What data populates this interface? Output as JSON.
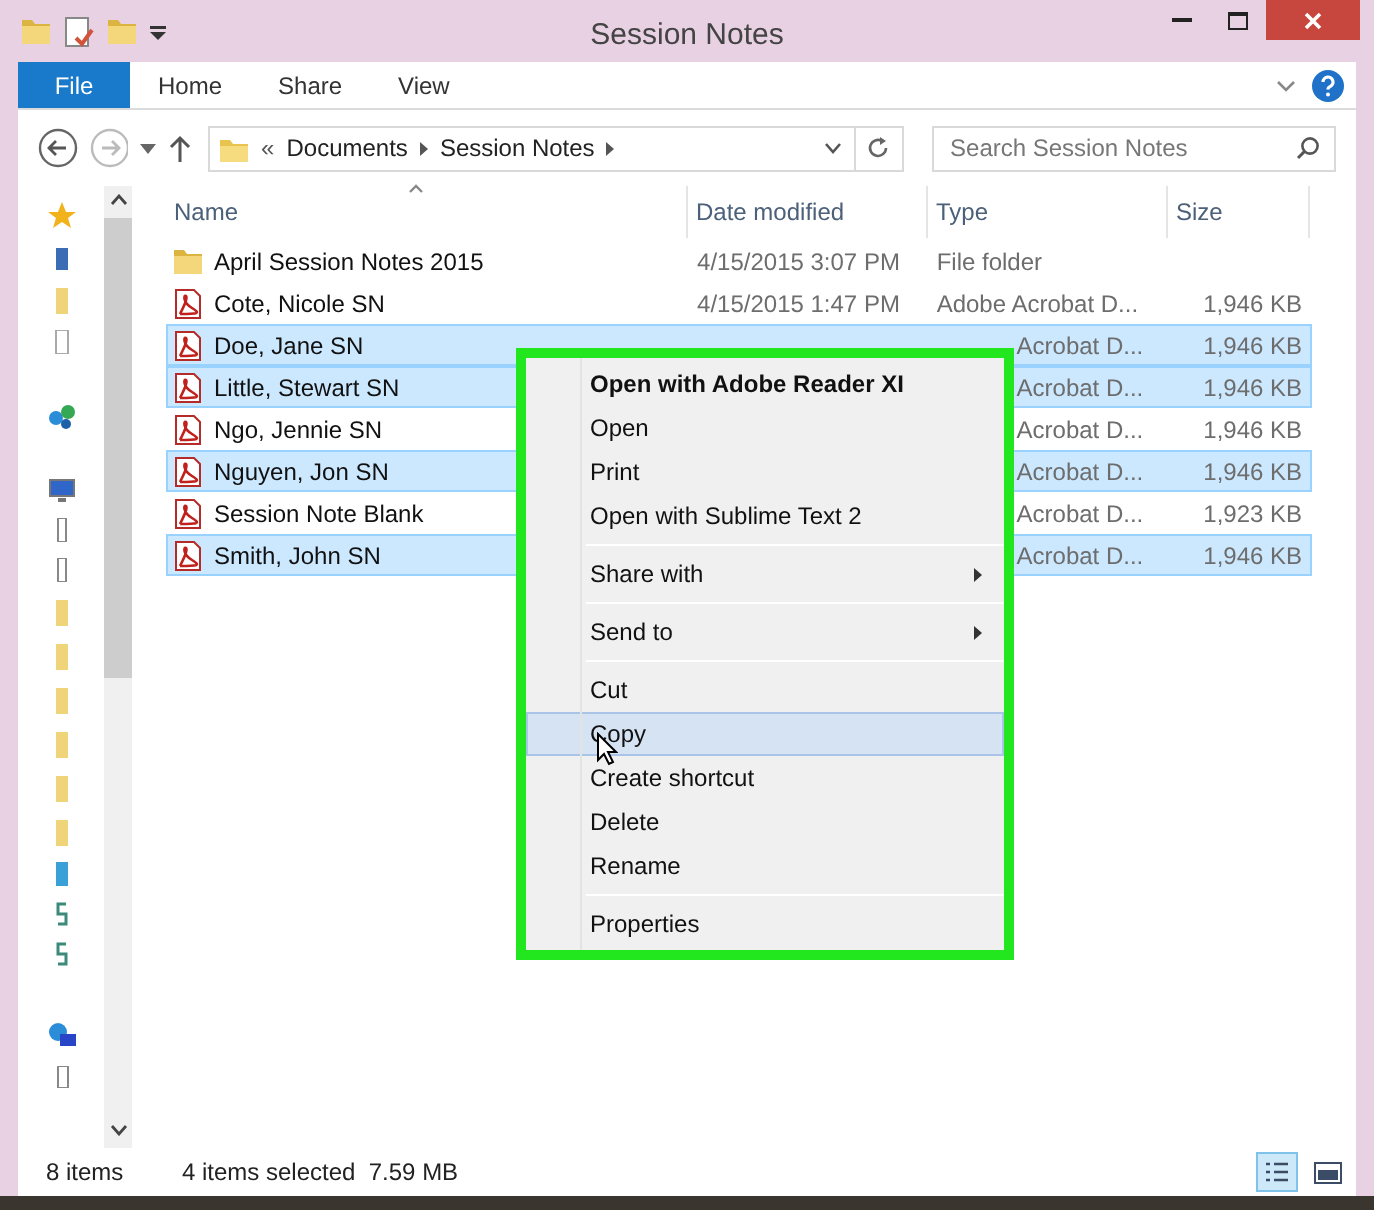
{
  "window": {
    "title": "Session Notes"
  },
  "ribbon_tabs": [
    {
      "label": "File",
      "selected": true
    },
    {
      "label": "Home",
      "selected": false
    },
    {
      "label": "Share",
      "selected": false
    },
    {
      "label": "View",
      "selected": false
    }
  ],
  "address_bar": {
    "overflow": "«",
    "path": [
      "Documents",
      "Session Notes"
    ]
  },
  "search": {
    "placeholder": "Search Session Notes"
  },
  "table": {
    "columns": [
      "Name",
      "Date modified",
      "Type",
      "Size"
    ],
    "rows": [
      {
        "kind": "folder",
        "name": "April Session Notes 2015",
        "date": "4/15/2015 3:07 PM",
        "type": "File folder",
        "selected": false,
        "covered": false
      },
      {
        "kind": "pdf",
        "name": "Cote, Nicole SN",
        "date": "4/15/2015 1:47 PM",
        "type": "Adobe Acrobat D...",
        "size": "1,946 KB",
        "selected": false,
        "covered": false
      },
      {
        "kind": "pdf",
        "name": "Doe, Jane SN",
        "type": "Acrobat D...",
        "size": "1,946 KB",
        "selected": true,
        "covered": true
      },
      {
        "kind": "pdf",
        "name": "Little, Stewart SN",
        "type": "Acrobat D...",
        "size": "1,946 KB",
        "selected": true,
        "covered": true
      },
      {
        "kind": "pdf",
        "name": "Ngo, Jennie SN",
        "type": "Acrobat D...",
        "size": "1,946 KB",
        "selected": false,
        "covered": true
      },
      {
        "kind": "pdf",
        "name": "Nguyen, Jon SN",
        "type": "Acrobat D...",
        "size": "1,946 KB",
        "selected": true,
        "covered": true
      },
      {
        "kind": "pdf",
        "name": "Session Note Blank",
        "type": "Acrobat D...",
        "size": "1,923 KB",
        "selected": false,
        "covered": true
      },
      {
        "kind": "pdf",
        "name": "Smith, John SN",
        "type": "Acrobat D...",
        "size": "1,946 KB",
        "selected": true,
        "covered": true
      }
    ]
  },
  "context_menu": {
    "items": [
      {
        "kind": "item",
        "label": "Open with Adobe Reader XI",
        "bold": true,
        "submenu": false,
        "selected": false
      },
      {
        "kind": "item",
        "label": "Open",
        "bold": false,
        "submenu": false,
        "selected": false
      },
      {
        "kind": "item",
        "label": "Print",
        "bold": false,
        "submenu": false,
        "selected": false
      },
      {
        "kind": "item",
        "label": "Open with Sublime Text 2",
        "bold": false,
        "submenu": false,
        "selected": false
      },
      {
        "kind": "separator"
      },
      {
        "kind": "item",
        "label": "Share with",
        "bold": false,
        "submenu": true,
        "selected": false
      },
      {
        "kind": "separator"
      },
      {
        "kind": "item",
        "label": "Send to",
        "bold": false,
        "submenu": true,
        "selected": false
      },
      {
        "kind": "separator"
      },
      {
        "kind": "item",
        "label": "Cut",
        "bold": false,
        "submenu": false,
        "selected": false
      },
      {
        "kind": "item",
        "label": "Copy",
        "bold": false,
        "submenu": false,
        "selected": true
      },
      {
        "kind": "item",
        "label": "Create shortcut",
        "bold": false,
        "submenu": false,
        "selected": false
      },
      {
        "kind": "item",
        "label": "Delete",
        "bold": false,
        "submenu": false,
        "selected": false
      },
      {
        "kind": "item",
        "label": "Rename",
        "bold": false,
        "submenu": false,
        "selected": false
      },
      {
        "kind": "separator"
      },
      {
        "kind": "item",
        "label": "Properties",
        "bold": false,
        "submenu": false,
        "selected": false
      }
    ]
  },
  "status_bar": {
    "count": "8 items",
    "selection": "4 items selected  7.59 MB"
  },
  "view_buttons": [
    {
      "kind": "details",
      "selected": true
    },
    {
      "kind": "large_icons",
      "selected": false
    }
  ]
}
